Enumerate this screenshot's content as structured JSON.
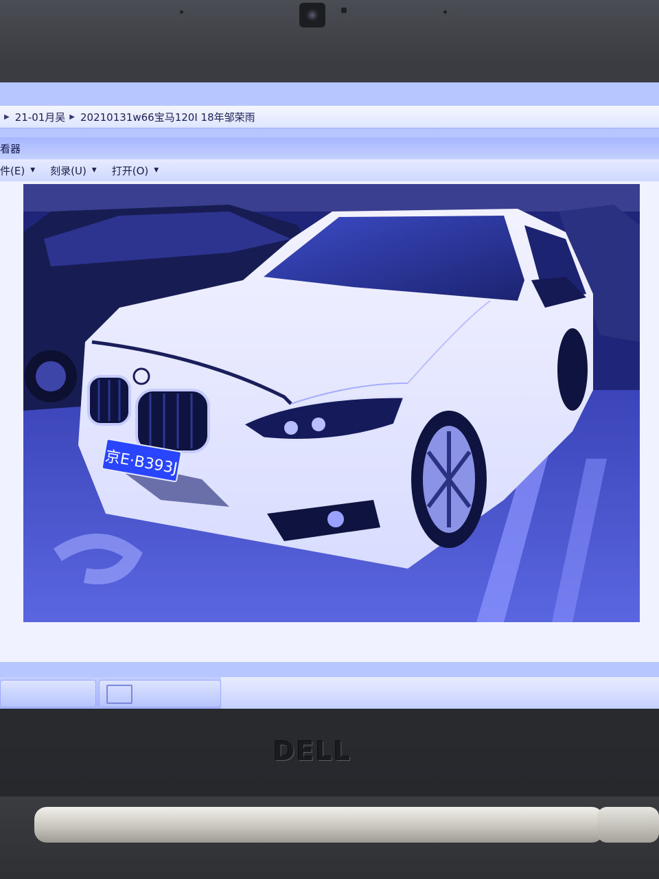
{
  "window": {
    "breadcrumb": [
      "21-01月吴",
      "20210131w66宝马120I 18年邹荣雨"
    ],
    "title_fragment": "看器"
  },
  "menubar": {
    "items": [
      {
        "label": "件(E)"
      },
      {
        "label": "刻录(U)"
      },
      {
        "label": "打开(O)"
      }
    ]
  },
  "photo": {
    "plate_text": "京E·B393J"
  },
  "toolbar": {
    "controls": [
      "zoom-icon",
      "fit-icon",
      "previous-icon",
      "slideshow-icon",
      "next-icon",
      "rotate-ccw-icon",
      "rotate-cw-icon",
      "delete-icon"
    ],
    "zoom_glyph": "⚲▾",
    "fit_glyph": "⊡",
    "prev_glyph": "⏮",
    "next_glyph": "⏭",
    "rotate_ccw_glyph": "↺",
    "rotate_cw_glyph": "↻",
    "delete_glyph": "✕"
  },
  "device": {
    "brand": "DELL"
  },
  "colors": {
    "screen_tint": "#b8c6ff",
    "delete_red": "#d83a3a",
    "chassis": "#2e3034"
  }
}
